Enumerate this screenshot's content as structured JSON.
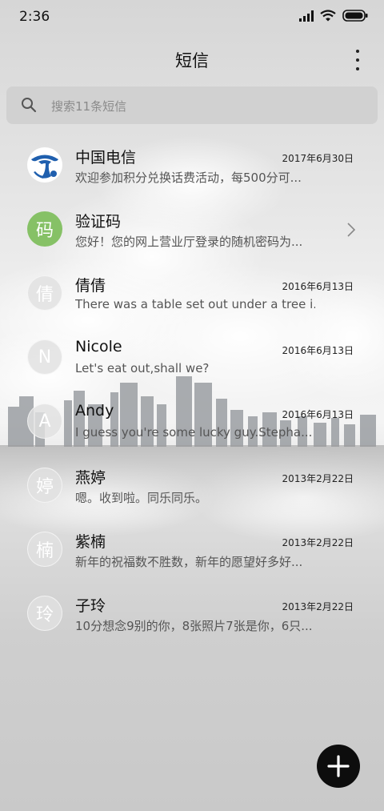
{
  "status_bar": {
    "time": "2:36",
    "icons": [
      "signal-icon",
      "wifi-icon",
      "battery-icon"
    ]
  },
  "header": {
    "title": "短信",
    "menu_icon": "more-vertical-icon"
  },
  "search": {
    "placeholder": "搜索11条短信",
    "icon": "search-icon"
  },
  "threads": [
    {
      "name": "中国电信",
      "date": "2017年6月30日",
      "preview": "欢迎参加积分兑换话费活动，每500分可...",
      "avatar_type": "logo",
      "avatar_text": ""
    },
    {
      "name": "验证码",
      "date": "",
      "preview": "您好！您的网上营业厅登录的随机密码为...",
      "avatar_type": "green",
      "avatar_text": "码",
      "has_chevron": true
    },
    {
      "name": "倩倩",
      "date": "2016年6月13日",
      "preview": "There was a table set out under a tree i...",
      "avatar_type": "plain",
      "avatar_text": "倩"
    },
    {
      "name": "Nicole",
      "date": "2016年6月13日",
      "preview": "Let's eat out,shall we?",
      "avatar_type": "plain",
      "avatar_text": "N"
    },
    {
      "name": "Andy",
      "date": "2016年6月13日",
      "preview": "I guess you're some lucky guy.Stepha...",
      "avatar_type": "plain",
      "avatar_text": "A"
    },
    {
      "name": "燕婷",
      "date": "2013年2月22日",
      "preview": "嗯。收到啦。同乐同乐。",
      "avatar_type": "plain",
      "avatar_text": "婷"
    },
    {
      "name": "紫楠",
      "date": "2013年2月22日",
      "preview": "新年的祝福数不胜数，新年的愿望好多好...",
      "avatar_type": "plain",
      "avatar_text": "楠"
    },
    {
      "name": "子玲",
      "date": "2013年2月22日",
      "preview": "10分想念9别的你，8张照片7张是你，6只...",
      "avatar_type": "plain",
      "avatar_text": "玲"
    }
  ],
  "fab": {
    "icon": "plus-icon"
  },
  "colors": {
    "fab": "#0d0d0d",
    "green_avatar": "#86c166",
    "telecom_blue": "#1f5fae"
  }
}
